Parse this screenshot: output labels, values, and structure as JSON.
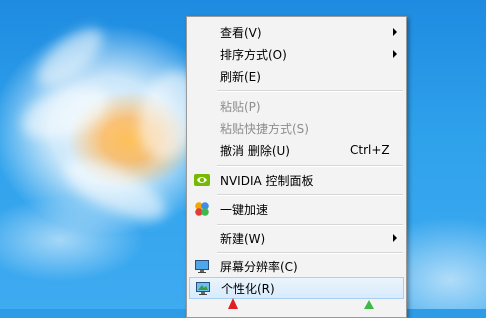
{
  "context_menu": {
    "items": [
      {
        "label": "查看(V)"
      },
      {
        "label": "排序方式(O)"
      },
      {
        "label": "刷新(E)"
      },
      {
        "label": "粘贴(P)"
      },
      {
        "label": "粘贴快捷方式(S)"
      },
      {
        "label": "撤消 删除(U)",
        "shortcut": "Ctrl+Z"
      },
      {
        "label": "NVIDIA 控制面板",
        "icon": "nvidia-icon"
      },
      {
        "label": "一键加速",
        "icon": "speedup-icon"
      },
      {
        "label": "新建(W)"
      },
      {
        "label": "屏幕分辨率(C)",
        "icon": "screen-resolution-icon"
      },
      {
        "label": "个性化(R)",
        "icon": "personalize-icon"
      }
    ]
  },
  "colors": {
    "menu_background": "#f3f3f3",
    "disabled_text": "#8d8d8d",
    "highlight": "#d8ebfb",
    "nvidia_green": "#76b900"
  }
}
